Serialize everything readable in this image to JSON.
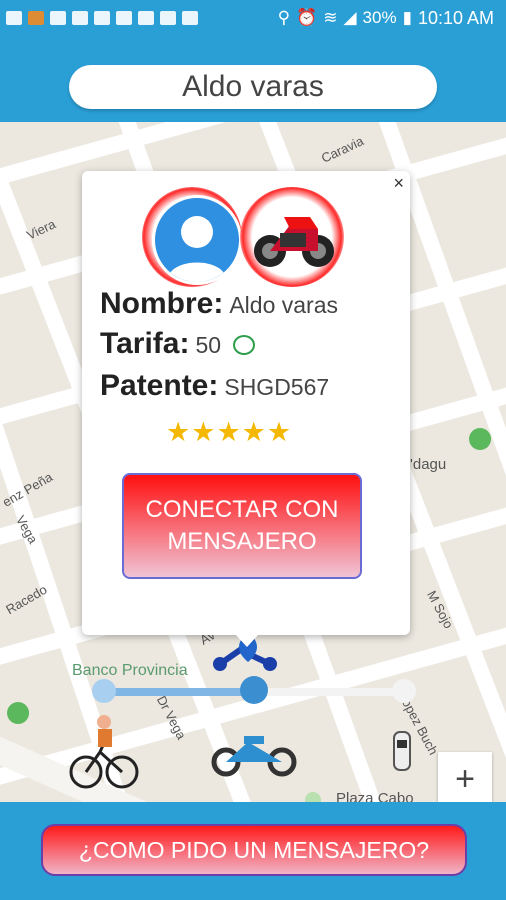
{
  "status_bar": {
    "battery": "30%",
    "time": "10:10 AM"
  },
  "header": {
    "name": "Aldo varas"
  },
  "map": {
    "streets": [
      "Caravia",
      "Viera",
      "enz Peña",
      "Vega",
      "Racedo",
      "Dr Vega",
      "M Sojo",
      "Lopez Buch",
      "Av",
      "'dagu"
    ],
    "places": [
      "Banco Provincia",
      "Plaza Cabo"
    ]
  },
  "card": {
    "close": "×",
    "name_label": "Nombre:",
    "name_value": "Aldo varas",
    "rate_label": "Tarifa:",
    "rate_value": "50",
    "plate_label": "Patente:",
    "plate_value": "SHGD567",
    "rating": 5,
    "connect_button": "CONECTAR CON MENSAJERO"
  },
  "zoom": {
    "plus": "+"
  },
  "bottom": {
    "how_button": "¿COMO PIDO UN MENSAJERO?"
  }
}
